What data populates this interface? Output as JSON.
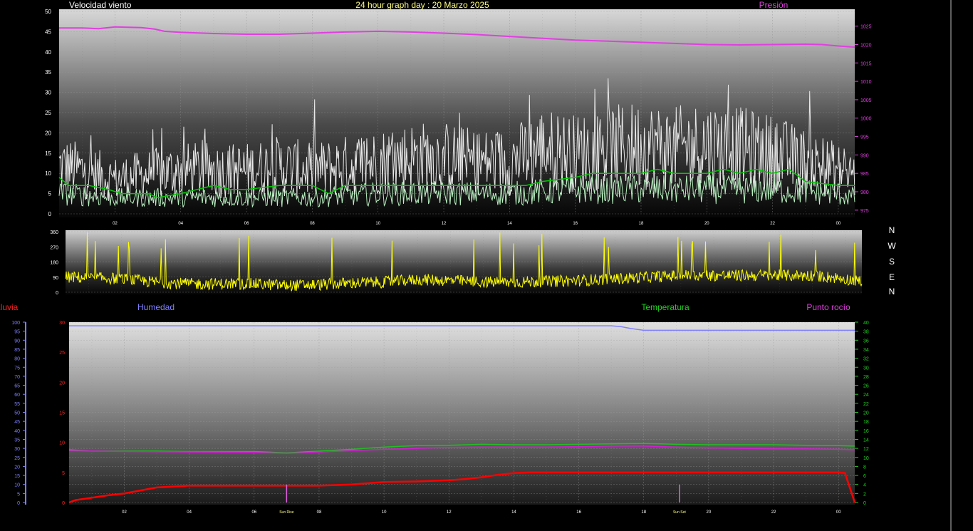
{
  "header": {
    "wind_title": "Velocidad viento",
    "graph_title": "24 hour graph day : 20 Marzo 2025",
    "pressure_title": "Presión"
  },
  "compass": [
    "N",
    "W",
    "S",
    "E",
    "N"
  ],
  "legend": {
    "rain": "Lluvia",
    "humidity": "Humedad",
    "temperature": "Temperatura",
    "dewpoint": "Punto rocío"
  },
  "colors": {
    "wind_gust": "#e8e8e8",
    "wind_avg": "#b8f0c0",
    "wind_ten_min": "#00c800",
    "pressure": "#e040e0",
    "direction": "#ffff00",
    "humidity": "#8080ff",
    "temperature": "#20c020",
    "dewpoint": "#d020d0",
    "rain": "#ff0000",
    "title": "#ffff80",
    "sun_marker": "#e060e0"
  },
  "chart_data": [
    {
      "type": "line",
      "title": "24 hour graph day : 20 Marzo 2025",
      "x_tick_labels": [
        "02",
        "04",
        "06",
        "08",
        "10",
        "12",
        "14",
        "16",
        "18",
        "20",
        "22",
        "00"
      ],
      "x_range_hours": [
        0.3,
        24.5
      ],
      "y_left_label": "Velocidad viento",
      "y_left_range": [
        0,
        50
      ],
      "y_left_ticks": [
        0,
        5,
        10,
        15,
        20,
        25,
        30,
        35,
        40,
        45,
        50
      ],
      "y_right_label": "Presión",
      "y_right_range": [
        974,
        1029
      ],
      "y_right_ticks": [
        975,
        980,
        985,
        990,
        995,
        1000,
        1005,
        1010,
        1015,
        1020,
        1025
      ],
      "grid": true,
      "series": [
        {
          "name": "Presión",
          "axis": "right",
          "hours": [
            0.3,
            1.0,
            1.5,
            2.0,
            2.8,
            3.2,
            3.5,
            4.0,
            5.0,
            6.0,
            7.0,
            8.0,
            9.0,
            10.0,
            11.0,
            12.0,
            13.0,
            14.0,
            15.0,
            16.0,
            17.0,
            18.0,
            19.0,
            20.0,
            21.0,
            22.0,
            23.0,
            23.5,
            24.0,
            24.5
          ],
          "values": [
            1024.5,
            1024.5,
            1024.3,
            1024.8,
            1024.6,
            1024.2,
            1023.6,
            1023.3,
            1023,
            1022.8,
            1022.8,
            1023.1,
            1023.4,
            1023.6,
            1023.4,
            1023.1,
            1022.7,
            1022.2,
            1021.7,
            1021.2,
            1020.9,
            1020.6,
            1020.3,
            1020.0,
            1019.9,
            1020.0,
            1020.1,
            1020.0,
            1019.6,
            1019.3
          ]
        },
        {
          "name": "gust",
          "axis": "left",
          "hours": [
            0.3,
            1,
            2,
            3,
            4,
            5,
            6,
            7,
            8,
            9,
            10,
            11,
            12,
            13,
            14,
            15,
            16,
            17,
            18,
            19,
            20,
            21,
            22,
            23,
            24,
            24.5
          ],
          "values": [
            11,
            10,
            8,
            9,
            10,
            10,
            10,
            11,
            10,
            11,
            12,
            13,
            13,
            12,
            12,
            15,
            14,
            15,
            16,
            15,
            16,
            15,
            14,
            12,
            10,
            9
          ]
        },
        {
          "name": "average",
          "axis": "left",
          "hours": [
            0.3,
            2,
            4,
            6,
            8,
            10,
            12,
            14,
            16,
            18,
            20,
            22,
            24,
            24.5
          ],
          "values": [
            5,
            4,
            4,
            4,
            4,
            5,
            5,
            5,
            6,
            6,
            6,
            6,
            5,
            4
          ]
        },
        {
          "name": "ten_minute",
          "axis": "left",
          "hours": [
            0.3,
            0.6,
            1.2,
            1.8,
            2.2,
            3.0,
            3.3,
            4.0,
            5.0,
            5.5,
            6.0,
            7.0,
            8.0,
            8.5,
            9.0,
            10.0,
            11.0,
            12.0,
            13.0,
            14.0,
            14.5,
            15.0,
            16.0,
            16.5,
            17.0,
            18.0,
            18.5,
            19.0,
            20.0,
            20.5,
            21.0,
            21.5,
            22.0,
            22.5,
            23.0,
            24.0,
            24.5
          ],
          "values": [
            9,
            7,
            7,
            6,
            5,
            5,
            4,
            5,
            7,
            6,
            6,
            7,
            7,
            5,
            7,
            7,
            7,
            7,
            7,
            7,
            7,
            8,
            9,
            10,
            10,
            10,
            11,
            10,
            10,
            11,
            10,
            11,
            10,
            11,
            8,
            7,
            7
          ]
        }
      ]
    },
    {
      "type": "line",
      "title": "",
      "x_range_hours": [
        0.3,
        24.5
      ],
      "y_range": [
        0,
        360
      ],
      "y_ticks": [
        0,
        90,
        180,
        270,
        360
      ],
      "grid": true,
      "series": [
        {
          "name": "direction",
          "hours": [
            0.3,
            2,
            3,
            4,
            5,
            6,
            7,
            8,
            9,
            10,
            11,
            12,
            13,
            14,
            15,
            16,
            17,
            18,
            19,
            20,
            21,
            22,
            23,
            24,
            24.5
          ],
          "values": [
            90,
            80,
            60,
            50,
            50,
            50,
            40,
            45,
            55,
            60,
            75,
            70,
            60,
            60,
            65,
            70,
            80,
            90,
            100,
            100,
            100,
            100,
            100,
            80,
            60
          ]
        }
      ]
    },
    {
      "type": "line",
      "title": "",
      "x_tick_labels": [
        "02",
        "04",
        "06",
        "08",
        "10",
        "12",
        "14",
        "16",
        "18",
        "20",
        "22",
        "00"
      ],
      "x_range_hours": [
        0.3,
        24.5
      ],
      "annotations": [
        {
          "text": "Sun Rise",
          "hour": 7.0
        },
        {
          "text": "Sun Set",
          "hour": 19.1
        }
      ],
      "y_rain_range": [
        0,
        30
      ],
      "y_rain_ticks": [
        0,
        5,
        10,
        15,
        20,
        25,
        30
      ],
      "y_humidity_range": [
        0,
        100
      ],
      "y_humidity_ticks": [
        0,
        5,
        10,
        15,
        20,
        25,
        30,
        35,
        40,
        45,
        50,
        55,
        60,
        65,
        70,
        75,
        80,
        85,
        90,
        95,
        100
      ],
      "y_temp_range": [
        0,
        40
      ],
      "y_temp_ticks": [
        0,
        2,
        4,
        6,
        8,
        10,
        12,
        14,
        16,
        18,
        20,
        22,
        24,
        26,
        28,
        30,
        32,
        34,
        36,
        38,
        40
      ],
      "grid": true,
      "series": [
        {
          "name": "Humedad",
          "axis": "humidity",
          "hours": [
            0.3,
            17.0,
            17.3,
            17.6,
            18.0,
            24.5
          ],
          "values": [
            98,
            98,
            97.5,
            96.5,
            95.5,
            95.5
          ]
        },
        {
          "name": "Temperatura",
          "axis": "temperature",
          "hours": [
            0.3,
            1.0,
            3.0,
            4.0,
            6.0,
            7.0,
            8.0,
            9.0,
            10.0,
            11.0,
            12.0,
            13.0,
            14.0,
            15.0,
            16.0,
            17.0,
            18.0,
            19.0,
            20.0,
            21.0,
            22.0,
            23.0,
            24.0,
            24.5
          ],
          "values": [
            11.7,
            11.4,
            11.4,
            11.3,
            11.3,
            11.0,
            11.4,
            11.8,
            12.3,
            12.6,
            12.7,
            12.9,
            12.8,
            12.8,
            12.9,
            13.0,
            13.1,
            12.9,
            12.8,
            12.8,
            12.8,
            12.7,
            12.6,
            12.5
          ]
        },
        {
          "name": "Punto rocío",
          "axis": "temperature",
          "hours": [
            0.3,
            2.0,
            4.0,
            6.0,
            7.0,
            8.0,
            9.0,
            10.0,
            11.0,
            12.0,
            13.0,
            14.0,
            15.0,
            16.0,
            17.0,
            18.0,
            19.0,
            20.0,
            21.0,
            22.0,
            23.0,
            24.0,
            24.5
          ],
          "values": [
            11.5,
            11.3,
            11.2,
            11.1,
            10.9,
            11.2,
            11.5,
            11.8,
            12.0,
            12.2,
            12.3,
            12.3,
            12.3,
            12.4,
            12.5,
            12.5,
            12.3,
            12.1,
            12.0,
            11.9,
            11.9,
            11.8,
            11.7
          ]
        },
        {
          "name": "Lluvia",
          "axis": "rain",
          "hours": [
            0.3,
            0.5,
            1.0,
            1.5,
            2.0,
            2.5,
            3.0,
            4.0,
            5.0,
            6.0,
            7.0,
            8.0,
            9.0,
            9.5,
            10.0,
            11.0,
            12.0,
            12.5,
            13.0,
            13.5,
            14.0,
            14.5,
            15.0,
            16.0,
            17.0,
            18.0,
            19.0,
            20.0,
            21.0,
            22.0,
            23.0,
            24.0,
            24.2,
            24.5
          ],
          "values": [
            0,
            0.4,
            0.8,
            1.2,
            1.5,
            2.0,
            2.5,
            2.8,
            2.8,
            2.8,
            2.8,
            2.8,
            3.0,
            3.2,
            3.4,
            3.5,
            3.7,
            3.9,
            4.2,
            4.6,
            4.9,
            5.0,
            5.0,
            5.0,
            5.0,
            5.0,
            5.0,
            5.0,
            5.0,
            5.0,
            5.0,
            5.0,
            4.9,
            0
          ]
        }
      ]
    }
  ]
}
